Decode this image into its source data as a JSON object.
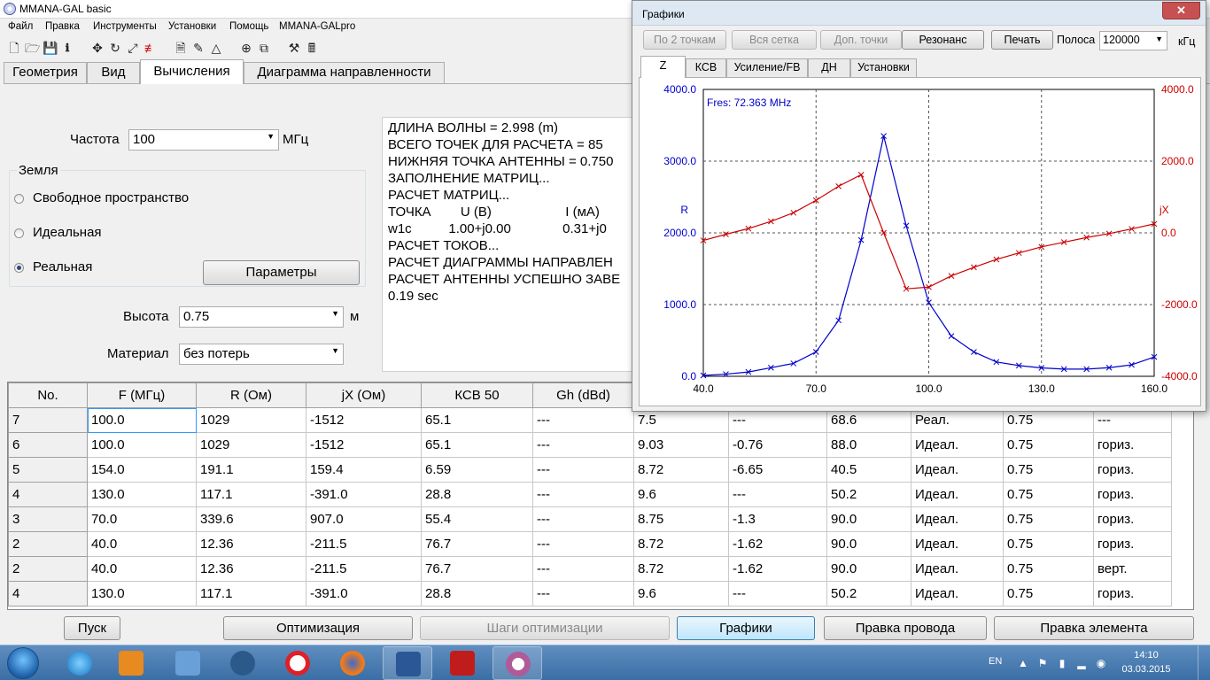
{
  "app": {
    "title": "MMANA-GAL basic"
  },
  "menu": [
    "Файл",
    "Правка",
    "Инструменты",
    "Установки",
    "Помощь",
    "MMANA-GALpro"
  ],
  "toolbar_icons": [
    "new-file-icon",
    "open-folder-icon",
    "save-icon",
    "info-icon",
    "move-icon",
    "rotate-icon",
    "scale-icon",
    "wires-icon",
    "doc-icon",
    "edit-icon",
    "triangle-icon",
    "target-icon",
    "copy-icon",
    "tools-icon",
    "calculator-icon"
  ],
  "tabs": [
    "Геометрия",
    "Вид",
    "Вычисления",
    "Диаграмма направленности"
  ],
  "calc": {
    "freq_label": "Частота",
    "freq_value": "100",
    "freq_unit": "МГц",
    "ground_title": "Земля",
    "ground_options": [
      "Свободное пространство",
      "Идеальная",
      "Реальная"
    ],
    "ground_selected": "Реальная",
    "params_button": "Параметры",
    "height_label": "Высота",
    "height_value": "0.75",
    "height_unit": "м",
    "material_label": "Материал",
    "material_value": "без потерь"
  },
  "log": [
    "ДЛИНА ВОЛНЫ = 2.998 (m)",
    "ВСЕГО ТОЧЕК ДЛЯ РАСЧЕТА = 85",
    "НИЖНЯЯ ТОЧКА АНТЕННЫ = 0.750",
    "ЗАПОЛНЕНИЕ МАТРИЦ...",
    "РАСЧЕТ МАТРИЦ...",
    "ТОЧКА        U (В)                    I (мА)",
    "w1c          1.00+j0.00              0.31+j0",
    "РАСЧЕТ ТОКОВ...",
    "РАСЧЕТ ДИАГРАММЫ НАПРАВЛЕН",
    "РАСЧЕТ АНТЕННЫ УСПЕШНО ЗАВЕ",
    "0.19 sec"
  ],
  "table": {
    "headers": [
      "No.",
      "F (МГц)",
      "R (Ом)",
      "jX (Ом)",
      "КСВ 50",
      "Gh (dBd)",
      "",
      "",
      "",
      "",
      "",
      ""
    ],
    "rows": [
      [
        "7",
        "100.0",
        "1029",
        "-1512",
        "65.1",
        "---",
        "7.5",
        "---",
        "68.6",
        "Реал.",
        "0.75",
        "---"
      ],
      [
        "6",
        "100.0",
        "1029",
        "-1512",
        "65.1",
        "---",
        "9.03",
        "-0.76",
        "88.0",
        "Идеал.",
        "0.75",
        "гориз."
      ],
      [
        "5",
        "154.0",
        "191.1",
        "159.4",
        "6.59",
        "---",
        "8.72",
        "-6.65",
        "40.5",
        "Идеал.",
        "0.75",
        "гориз."
      ],
      [
        "4",
        "130.0",
        "117.1",
        "-391.0",
        "28.8",
        "---",
        "9.6",
        " ---",
        "50.2",
        "Идеал.",
        "0.75",
        "гориз."
      ],
      [
        "3",
        "70.0",
        "339.6",
        "907.0",
        "55.4",
        "---",
        "8.75",
        "-1.3",
        "90.0",
        "Идеал.",
        "0.75",
        "гориз."
      ],
      [
        "2",
        "40.0",
        "12.36",
        "-211.5",
        "76.7",
        "---",
        "8.72",
        "-1.62",
        "90.0",
        "Идеал.",
        "0.75",
        "гориз."
      ],
      [
        "2",
        "40.0",
        "12.36",
        "-211.5",
        "76.7",
        "---",
        "8.72",
        "-1.62",
        "90.0",
        "Идеал.",
        "0.75",
        "верт."
      ],
      [
        "4",
        "130.0",
        "117.1",
        "-391.0",
        "28.8",
        "---",
        "9.6",
        " ---",
        "50.2",
        "Идеал.",
        "0.75",
        "гориз."
      ]
    ]
  },
  "bottom_buttons": {
    "run": "Пуск",
    "optimize": "Оптимизация",
    "opt_steps": "Шаги оптимизации",
    "graphs": "Графики",
    "edit_wire": "Правка провода",
    "edit_element": "Правка элемента"
  },
  "graph_window": {
    "title": "Графики",
    "close": "✕",
    "buttons": [
      "По 2 точкам",
      "Вся сетка",
      "Доп. точки",
      "Резонанс",
      "Печать"
    ],
    "band_label": "Полоса",
    "band_value": "120000",
    "band_unit": "кГц",
    "tabs": [
      "Z",
      "КСВ",
      "Усиление/FB",
      "ДН",
      "Установки"
    ],
    "fres_label": "Fres: 72.363 MHz"
  },
  "chart_data": {
    "type": "line",
    "x": [
      40,
      46,
      52,
      58,
      64,
      70,
      76,
      82,
      88,
      94,
      100,
      106,
      112,
      118,
      124,
      130,
      136,
      142,
      148,
      154,
      160
    ],
    "xlim": [
      40,
      160
    ],
    "xticks": [
      "40.0",
      "70.0",
      "100.0",
      "130.0",
      "160.0"
    ],
    "grid": true,
    "series": [
      {
        "name": "R",
        "axis": "left",
        "color": "#0000cc",
        "ylim": [
          0,
          4000
        ],
        "yticks": [
          "0.0",
          "1000.0",
          "2000.0",
          "3000.0",
          "4000.0"
        ],
        "values": [
          12,
          30,
          60,
          120,
          180,
          340,
          780,
          1900,
          3350,
          2100,
          1029,
          560,
          340,
          200,
          150,
          117,
          100,
          100,
          120,
          160,
          270
        ]
      },
      {
        "name": "jX",
        "axis": "right",
        "color": "#cc0000",
        "ylim": [
          -4000,
          4000
        ],
        "yticks": [
          "-4000.0",
          "-2000.0",
          "0.0",
          "2000.0",
          "4000.0"
        ],
        "values": [
          -211,
          -40,
          120,
          320,
          560,
          907,
          1300,
          1620,
          0,
          -1560,
          -1512,
          -1200,
          -960,
          -740,
          -560,
          -391,
          -260,
          -130,
          -20,
          110,
          250
        ]
      }
    ]
  },
  "taskbar": {
    "lang": "EN",
    "time": "14:10",
    "date": "03.03.2015"
  }
}
